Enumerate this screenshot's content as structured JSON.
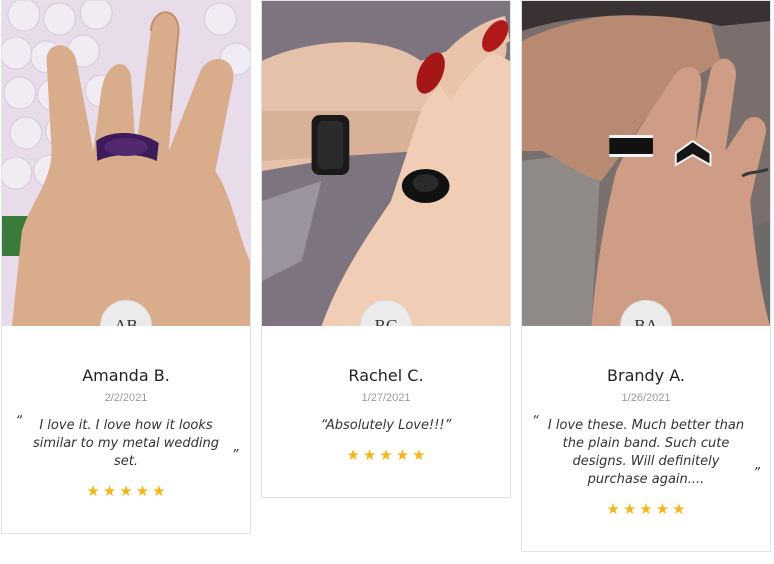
{
  "reviews": [
    {
      "initials": "AB",
      "name": "Amanda B.",
      "date": "2/2/2021",
      "quote_open": "“",
      "text": "I love it. I love how it looks similar to my metal wedding set.",
      "quote_close": "”",
      "rating": 5
    },
    {
      "initials": "RC",
      "name": "Rachel C.",
      "date": "1/27/2021",
      "quote_open": "",
      "text": "“Absolutely Love!!!”",
      "quote_close": "",
      "rating": 5
    },
    {
      "initials": "BA",
      "name": "Brandy A.",
      "date": "1/26/2021",
      "quote_open": "“",
      "text": "I love these. Much better than the plain band. Such cute designs. Will definitely purchase again....",
      "quote_close": "”",
      "rating": 5
    }
  ],
  "colors": {
    "star": "#f3b51a",
    "verified": "#f3b51a",
    "border": "#e3e3e3"
  },
  "icons": {
    "verified": "check-badge-icon",
    "star": "star-icon"
  }
}
